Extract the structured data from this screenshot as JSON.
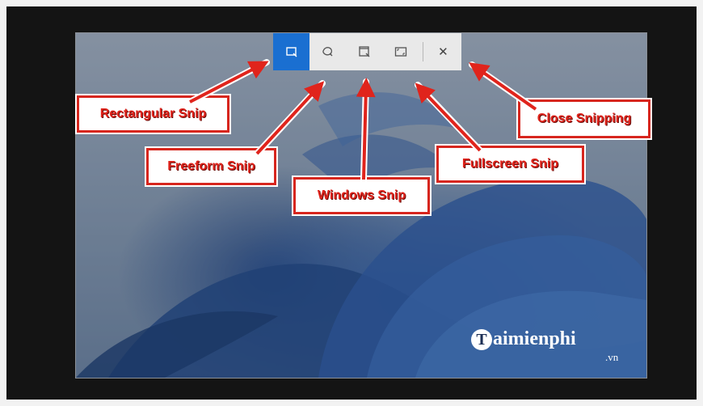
{
  "snipping_toolbar": {
    "tools": [
      {
        "name": "rectangular-snip",
        "active": true
      },
      {
        "name": "freeform-snip",
        "active": false
      },
      {
        "name": "window-snip",
        "active": false
      },
      {
        "name": "fullscreen-snip",
        "active": false
      }
    ],
    "close_symbol": "✕"
  },
  "callouts": {
    "rectangular": "Rectangular Snip",
    "freeform": "Freeform Snip",
    "windows": "Windows Snip",
    "fullscreen": "Fullscreen Snip",
    "close": "Close Snipping"
  },
  "logo": {
    "mark": "T",
    "text": "aimienphi",
    "suffix": ".vn"
  },
  "colors": {
    "active_tool": "#1a6fd1",
    "toolbar": "#e9e9e9",
    "callout_text": "#e0241c",
    "callout_border": "#d7261e",
    "arrow": "#e0241c"
  }
}
